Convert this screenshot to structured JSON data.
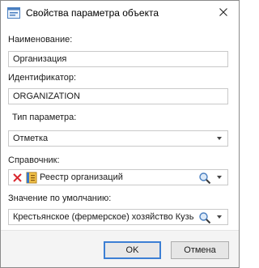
{
  "window": {
    "title": "Свойства параметра объекта"
  },
  "form": {
    "name_label": "Наименование:",
    "name_value": "Организация",
    "id_label": "Идентификатор:",
    "id_value": "ORGANIZATION",
    "type_label": "Тип параметра:",
    "type_value": "Отметка",
    "ref_label": "Справочник:",
    "ref_value": "Реестр организаций",
    "default_label": "Значение по умолчанию:",
    "default_value": "Крестьянское (фермерское) хозяйство Кузь"
  },
  "buttons": {
    "ok": "OK",
    "cancel": "Отмена"
  },
  "colors": {
    "accent": "#3c7fd4",
    "clear_x": "#d9272e"
  }
}
